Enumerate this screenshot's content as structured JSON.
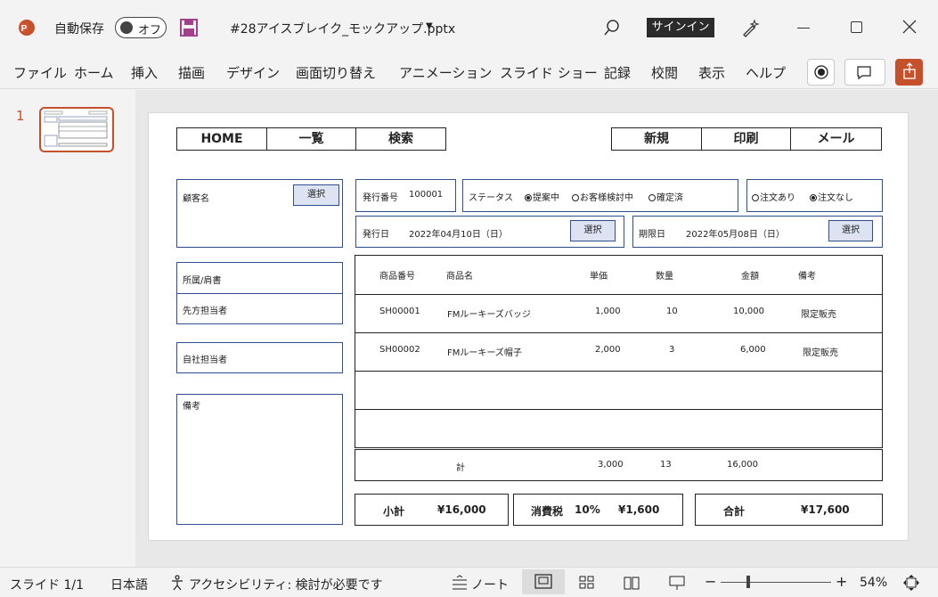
{
  "titlebar": {
    "autosave_label": "自動保存",
    "autosave_state": "オフ",
    "filename": "#28アイスブレイク_モックアップ.pptx",
    "signin_label": "サインイン"
  },
  "ribbon": {
    "tabs": [
      "ファイル",
      "ホーム",
      "挿入",
      "描画",
      "デザイン",
      "画面切り替え",
      "アニメーション",
      "スライド ショー",
      "記録",
      "校閲",
      "表示",
      "ヘルプ"
    ]
  },
  "thumbnails": {
    "slide_number": "1"
  },
  "slide": {
    "nav_left": [
      "HOME",
      "一覧",
      "検索"
    ],
    "nav_right": [
      "新規",
      "印刷",
      "メール"
    ],
    "customer_label": "顧客名",
    "select_label": "選択",
    "issue_no_label": "発行番号",
    "issue_no_value": "100001",
    "status_label": "ステータス",
    "status_options": [
      "提案中",
      "お客様検討中",
      "確定済"
    ],
    "order_options": [
      "注文あり",
      "注文なし"
    ],
    "issue_date_label": "発行日",
    "issue_date_value": "2022年04月10日（日）",
    "due_date_label": "期限日",
    "due_date_value": "2022年05月08日（日）",
    "dept_label": "所属/肩書",
    "client_contact_label": "先方担当者",
    "own_contact_label": "自社担当者",
    "notes_label": "備考",
    "table": {
      "headers": [
        "商品番号",
        "商品名",
        "単価",
        "数量",
        "金額",
        "備考"
      ],
      "rows": [
        [
          "SH00001",
          "FMルーキーズバッジ",
          "1,000",
          "10",
          "10,000",
          "限定販売"
        ],
        [
          "SH00002",
          "FMルーキーズ帽子",
          "2,000",
          "3",
          "6,000",
          "限定販売"
        ]
      ]
    },
    "totals_row": {
      "label": "計",
      "unit_total": "3,000",
      "qty_total": "13",
      "amount_total": "16,000"
    },
    "subtotal_label": "小計",
    "subtotal_value": "¥16,000",
    "tax_label": "消費税",
    "tax_rate": "10%",
    "tax_value": "¥1,600",
    "grand_label": "合計",
    "grand_value": "¥17,600"
  },
  "status": {
    "slide_info": "スライド 1/1",
    "language": "日本語",
    "accessibility": "アクセシビリティ: 検討が必要です",
    "notes": "ノート",
    "zoom": "54%"
  },
  "colors": {
    "accent": "#c4502c",
    "box_border": "#2f4f8f",
    "select_fill": "#dde3f2"
  }
}
